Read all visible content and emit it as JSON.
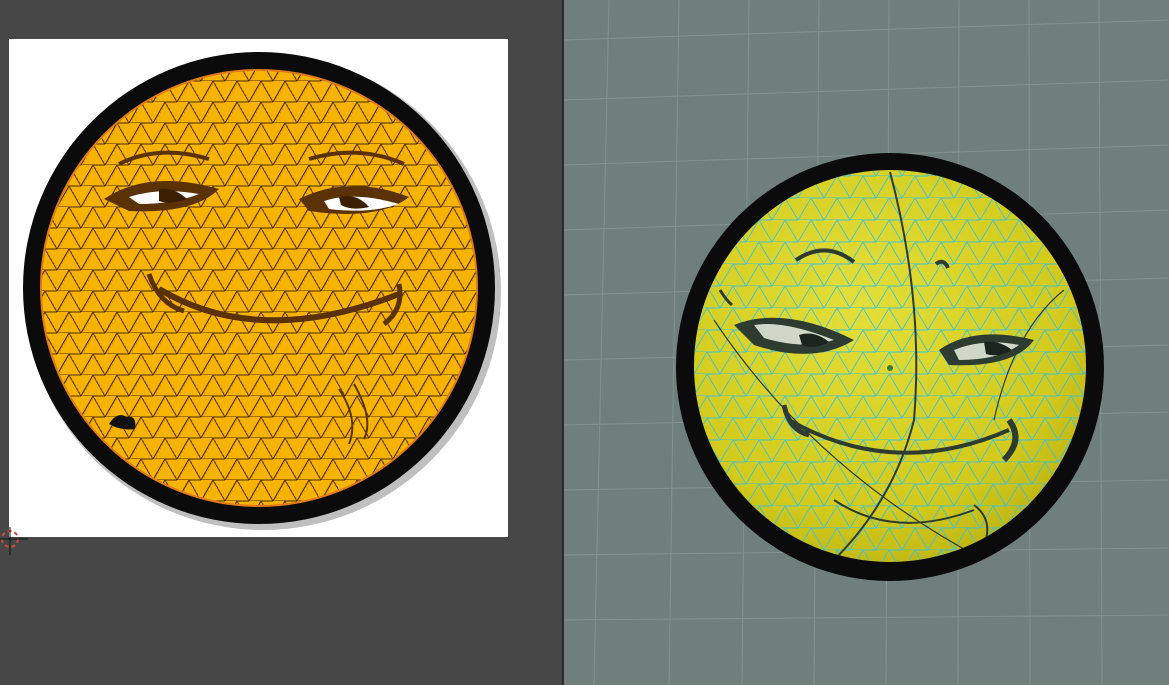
{
  "uv_editor": {
    "image_background": "#ffffff",
    "panel_background": "#474747",
    "uv_wire_color": "#e07a1a",
    "texture": {
      "face_fill": "#f6b400",
      "rim_color": "#0b0b0b",
      "feature_color": "#5a3206"
    },
    "cursor_icon": "2d-cursor-icon"
  },
  "viewport_3d": {
    "background": "#6f7f7b",
    "grid_color": "#84938f",
    "mesh_wire_color": "#3fc2d8",
    "sphere": {
      "face_fill": "#d9d21f",
      "rim_color": "#0b0b0b",
      "feature_color": "#2d3b30"
    }
  }
}
